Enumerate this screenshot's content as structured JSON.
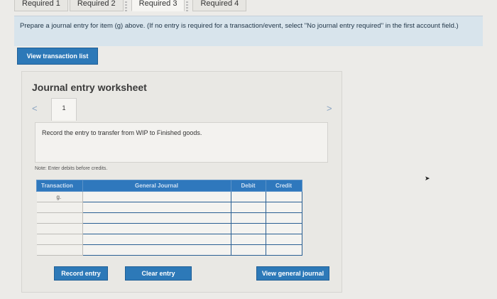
{
  "tabs": [
    {
      "label": "Required 1"
    },
    {
      "label": "Required 2"
    },
    {
      "label": "Required 3"
    },
    {
      "label": "Required 4"
    }
  ],
  "instructions": "Prepare a journal entry for item (g) above. (If no entry is required for a transaction/event, select \"No journal entry required\" in the first account field.)",
  "view_transaction_button": "View transaction list",
  "worksheet": {
    "title": "Journal entry worksheet",
    "entry_number": "1",
    "description": "Record the entry to transfer from WIP to Finished goods.",
    "note": "Note: Enter debits before credits.",
    "columns": [
      "Transaction",
      "General Journal",
      "Debit",
      "Credit"
    ],
    "rows": [
      {
        "transaction": "g.",
        "account": "",
        "debit": "",
        "credit": ""
      },
      {
        "transaction": "",
        "account": "",
        "debit": "",
        "credit": ""
      },
      {
        "transaction": "",
        "account": "",
        "debit": "",
        "credit": ""
      },
      {
        "transaction": "",
        "account": "",
        "debit": "",
        "credit": ""
      },
      {
        "transaction": "",
        "account": "",
        "debit": "",
        "credit": ""
      },
      {
        "transaction": "",
        "account": "",
        "debit": "",
        "credit": ""
      }
    ],
    "buttons": {
      "record": "Record entry",
      "clear": "Clear entry",
      "view_journal": "View general journal"
    }
  }
}
